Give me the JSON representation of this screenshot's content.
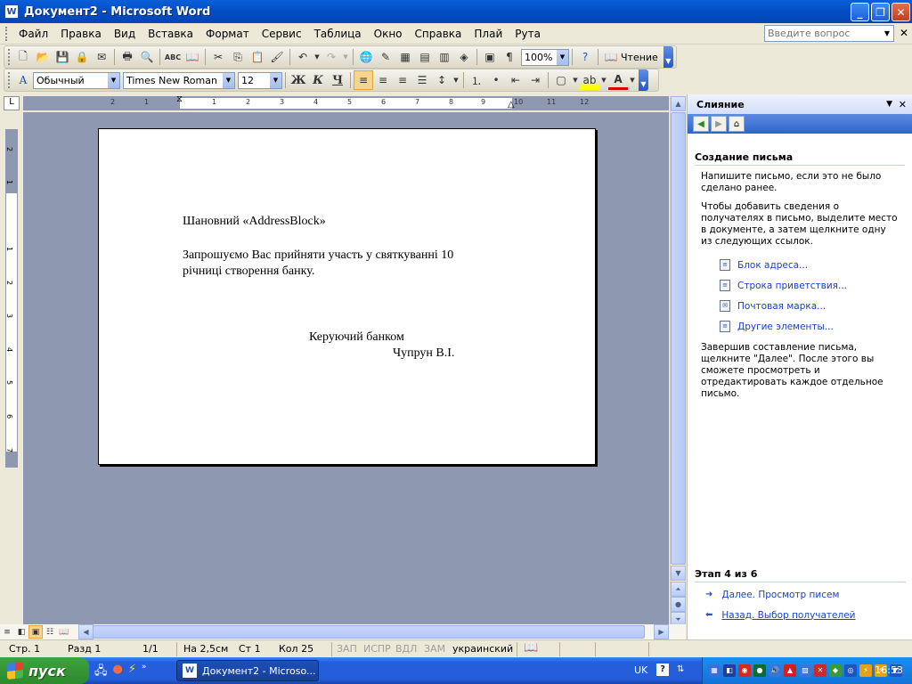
{
  "window": {
    "title": "Документ2 - Microsoft Word",
    "app_icon": "W"
  },
  "menu": {
    "items": [
      "Файл",
      "Правка",
      "Вид",
      "Вставка",
      "Формат",
      "Сервис",
      "Таблица",
      "Окно",
      "Справка",
      "Плай",
      "Рута"
    ],
    "help_placeholder": "Введите вопрос"
  },
  "standard_toolbar": {
    "zoom": "100%",
    "reading_label": "Чтение"
  },
  "formatting_toolbar": {
    "style": "Обычный",
    "font": "Times New Roman",
    "size": "12",
    "bold": "Ж",
    "italic": "К",
    "underline": "Ч"
  },
  "ruler": {
    "h_ticks": [
      "2",
      "1",
      "1",
      "2",
      "3",
      "4",
      "5",
      "6",
      "7",
      "8",
      "9",
      "10",
      "11",
      "12"
    ],
    "v_ticks": [
      "2",
      "1",
      "1",
      "2",
      "3",
      "4",
      "5",
      "6",
      "7"
    ]
  },
  "document": {
    "greeting": "Шановний  «AddressBlock»",
    "body_line1": "Запрошуємо Вас прийняти участь у святкуванні 10",
    "body_line2": "річниці створення банку.",
    "sign_title": "Керуючий банком",
    "sign_name": "Чупрун В.І."
  },
  "task_pane": {
    "title": "Слияние",
    "section_title": "Создание письма",
    "intro_text": "Напишите письмо, если это не было сделано ранее.",
    "instruction_text": "Чтобы добавить сведения о получателях в письмо, выделите место в документе, а затем щелкните одну из следующих ссылок.",
    "links": [
      "Блок адреса...",
      "Строка приветствия...",
      "Почтовая марка...",
      "Другие элементы..."
    ],
    "finish_text": "Завершив составление письма, щелкните \"Далее\". После этого вы сможете просмотреть и отредактировать каждое отдельное письмо.",
    "step_label": "Этап 4 из 6",
    "next_link": "Далее. Просмотр писем",
    "back_link": "Назад. Выбор получателей"
  },
  "status_bar": {
    "page": "Стр. 1",
    "section": "Разд 1",
    "page_of": "1/1",
    "at": "На 2,5см",
    "line": "Ст 1",
    "column": "Кол 25",
    "rec": "ЗАП",
    "trk": "ИСПР",
    "ext": "ВДЛ",
    "ovr": "ЗАМ",
    "language": "украинский"
  },
  "taskbar": {
    "start_label": "пуск",
    "task_label": "Документ2 - Microso...",
    "lang": "UK",
    "clock": "16:53"
  }
}
